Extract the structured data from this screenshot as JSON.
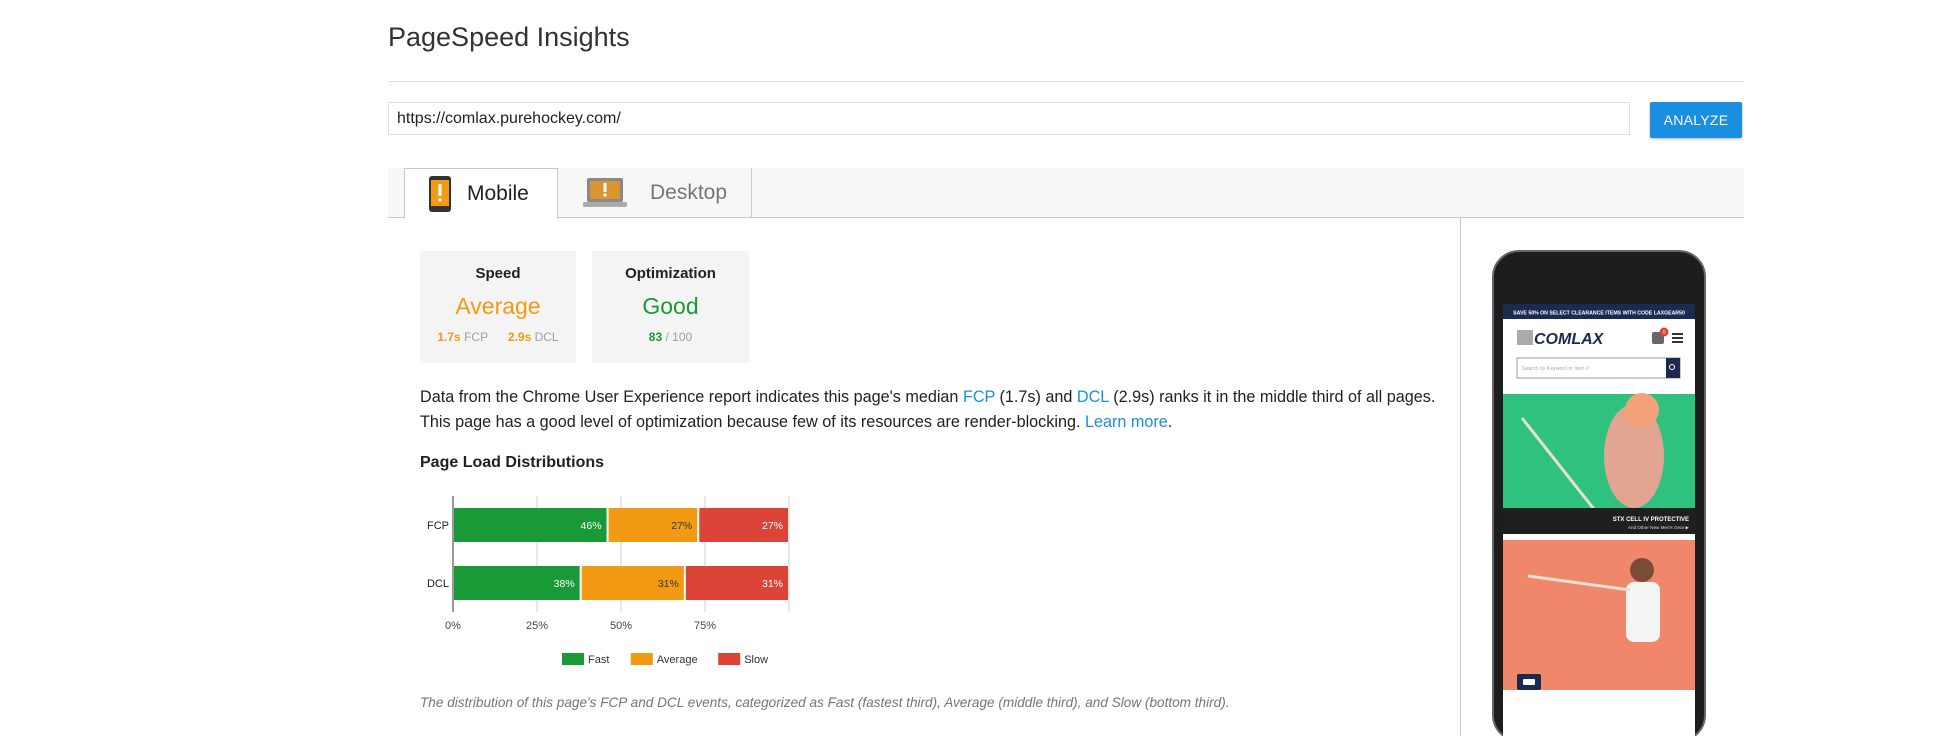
{
  "app": {
    "title": "PageSpeed Insights"
  },
  "search": {
    "url_value": "https://comlax.purehockey.com/",
    "analyze_label": "ANALYZE"
  },
  "tabs": [
    {
      "label": "Mobile",
      "icon": "mobile-phone-warning-icon",
      "active": true
    },
    {
      "label": "Desktop",
      "icon": "laptop-warning-icon",
      "active": false
    }
  ],
  "cards": {
    "speed": {
      "heading": "Speed",
      "value": "Average",
      "fcp_value": "1.7s",
      "fcp_label": "FCP",
      "dcl_value": "2.9s",
      "dcl_label": "DCL"
    },
    "optimization": {
      "heading": "Optimization",
      "value": "Good",
      "score": "83",
      "score_suffix": "/ 100"
    }
  },
  "description": {
    "part1": "Data from the Chrome User Experience report indicates this page's median ",
    "fcp_link": "FCP",
    "part2": " (1.7s) and ",
    "dcl_link": "DCL",
    "part3": " (2.9s) ranks it in the middle third of all pages. This page has a good level of optimization because few of its resources are render-blocking. ",
    "learn_more": "Learn more",
    "part4": "."
  },
  "section": {
    "heading": "Page Load Distributions"
  },
  "chart_data": {
    "type": "bar",
    "orientation": "horizontal-stacked",
    "categories": [
      "FCP",
      "DCL"
    ],
    "series": [
      {
        "name": "Fast",
        "values": [
          46,
          38
        ],
        "labels": [
          "46%",
          "38%"
        ],
        "color": "#1a9a37"
      },
      {
        "name": "Average",
        "values": [
          27,
          31
        ],
        "labels": [
          "27%",
          "31%"
        ],
        "color": "#f39a14"
      },
      {
        "name": "Slow",
        "values": [
          27,
          31
        ],
        "labels": [
          "27%",
          "31%"
        ],
        "color": "#dc4437"
      }
    ],
    "xticks": [
      "0%",
      "25%",
      "50%",
      "75%"
    ],
    "xlim": [
      0,
      100
    ],
    "legend": "bottom",
    "grid": true
  },
  "caption": "The distribution of this page's FCP and DCL events, categorized as Fast (fastest third), Average (middle third), and Slow (bottom third).",
  "phone_preview": {
    "banner_text": "SAVE 50% ON SELECT CLEARANCE ITEMS WITH CODE LAXGEAR50",
    "logo": "COMLAX",
    "cart_count": "0",
    "search_placeholder": "Search by Keyword or Item #",
    "hero_title": "STX CELL IV PROTECTIVE",
    "hero_sub": "And Other New Men's Gear ▶"
  },
  "colors": {
    "accent": "#1a8ee1",
    "fast": "#1a9a37",
    "average": "#f39a14",
    "slow": "#dc4437"
  }
}
